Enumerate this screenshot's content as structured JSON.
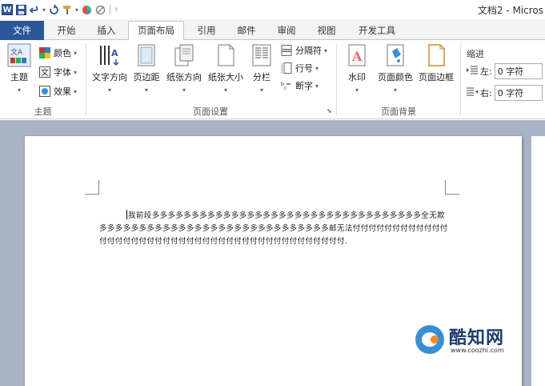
{
  "titlebar": {
    "app_icon": "W",
    "title": "文档2 - Micros"
  },
  "tabs": {
    "file": "文件",
    "items": [
      "开始",
      "插入",
      "页面布局",
      "引用",
      "邮件",
      "审阅",
      "视图",
      "开发工具"
    ],
    "active": "页面布局"
  },
  "ribbon": {
    "theme": {
      "theme_btn": "主题",
      "colors": "颜色",
      "fonts": "字体",
      "effects": "效果",
      "group": "主题"
    },
    "page_setup": {
      "text_direction": "文字方向",
      "margins": "页边距",
      "orientation": "纸张方向",
      "size": "纸张大小",
      "columns": "分栏",
      "breaks": "分隔符",
      "line_numbers": "行号",
      "hyphenation": "断字",
      "group": "页面设置"
    },
    "page_background": {
      "watermark": "水印",
      "page_color": "页面颜色",
      "page_borders": "页面边框",
      "group": "页面背景"
    },
    "indent": {
      "title": "缩进",
      "left_label": "左:",
      "right_label": "右:",
      "left_value": "0 字符",
      "right_value": "0 字符"
    }
  },
  "document": {
    "line1": "我前段多多多多多多多多多多多多多多多多多多多多多多多多多多多多多多多多多",
    "line2": "多全无欺多多多多多多多多多多多多多多多多多多多多多多多多多多多多多邮无法付付付",
    "line3": "付付付付付付付付付付付付付付付付付付付付付付付付付付付付付付付付付付付付付付付付."
  },
  "watermark_logo": {
    "name": "酷知网",
    "url": "www.coozhi.com"
  },
  "colors": {
    "file_tab": "#2b579a",
    "doc_bg": "#a8b3c3",
    "accent_orange": "#f08a24"
  }
}
